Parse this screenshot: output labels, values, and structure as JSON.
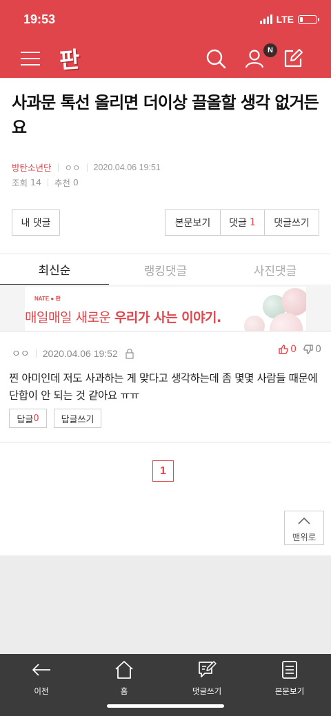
{
  "status": {
    "time": "19:53",
    "network": "LTE",
    "battery_level": 0.2
  },
  "header": {
    "logo": "판",
    "notification_badge": "N",
    "icons": [
      "menu-icon",
      "search-icon",
      "user-icon",
      "write-icon"
    ]
  },
  "post": {
    "title": "사과문 톡선 올리면 더이상 끌올할 생각 없거든요",
    "category": "방탄소년단",
    "author": "ㅇㅇ",
    "datetime": "2020.04.06 19:51",
    "views_label": "조회",
    "views": "14",
    "recommend_label": "추천",
    "recommend": "0"
  },
  "actions": {
    "my_comments": "내 댓글",
    "view_post": "본문보기",
    "comments_label": "댓글",
    "comments_count": "1",
    "write_comment": "댓글쓰기"
  },
  "tabs": [
    {
      "label": "최신순",
      "active": true
    },
    {
      "label": "랭킹댓글",
      "active": false
    },
    {
      "label": "사진댓글",
      "active": false
    }
  ],
  "ad": {
    "brand": "NATE",
    "brand_sub": "판",
    "text_plain": "매일매일 새로운 ",
    "text_bold": "우리가 사는 이야기."
  },
  "comment": {
    "author": "ㅇㅇ",
    "datetime": "2020.04.06 19:52",
    "likes": "0",
    "dislikes": "0",
    "body": "찐 아미인데 저도 사과하는 게 맞다고 생각하는데 좀 몇몇 사람들 때문에 단합이 안 되는 것 같아요 ㅠㅠ",
    "reply_label": "답글",
    "reply_count": "0",
    "write_reply": "답글쓰기"
  },
  "pagination": {
    "current": "1"
  },
  "scroll_top": "맨위로",
  "bottom_nav": [
    {
      "label": "이전",
      "icon": "back-arrow-icon"
    },
    {
      "label": "홈",
      "icon": "home-icon"
    },
    {
      "label": "댓글쓰기",
      "icon": "comment-write-icon"
    },
    {
      "label": "본문보기",
      "icon": "document-icon"
    }
  ],
  "colors": {
    "brand": "#e0454b",
    "nav_bg": "#3b3b3b"
  }
}
